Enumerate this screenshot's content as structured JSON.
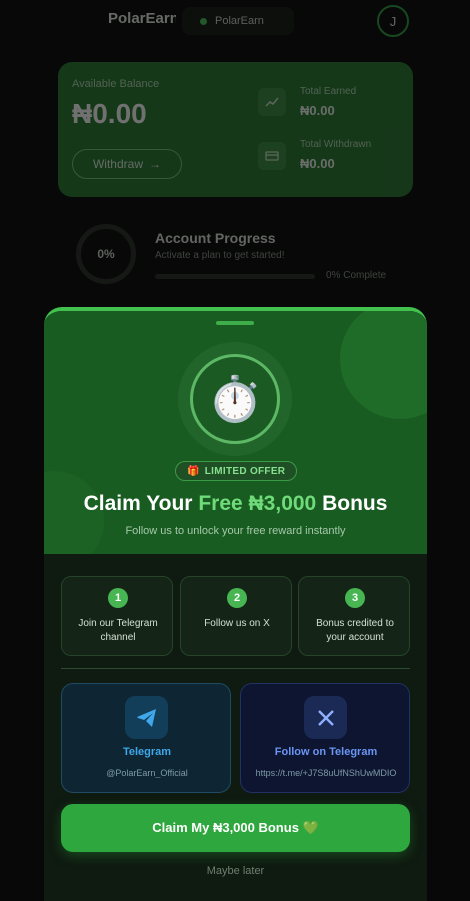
{
  "app": {
    "logo_text": "PolarEarn",
    "brand_pill": "PolarEarn",
    "avatar_initial": "J"
  },
  "balance": {
    "label": "Available Balance",
    "value": "₦0.00",
    "withdraw_label": "Withdraw",
    "withdraw_icon": "→",
    "total_earned_label": "Total Earned",
    "total_earned_value": "₦0.00",
    "total_withdrawn_label": "Total Withdrawn",
    "total_withdrawn_value": "₦0.00"
  },
  "progress": {
    "percent_text": "0%",
    "title": "Account Progress",
    "subtitle": "Activate a plan to get started!",
    "complete_text": "0% Complete",
    "fraction": 0
  },
  "modal": {
    "badge_icon": "🎁",
    "badge_text": "LIMITED OFFER",
    "timer_icon": "⏱️",
    "headline_prefix": "Claim Your ",
    "headline_highlight": "Free ₦3,000",
    "headline_suffix": " Bonus",
    "subheadline": "Follow us to unlock your free reward instantly",
    "steps": [
      {
        "num": "1",
        "text": "Join our Telegram channel"
      },
      {
        "num": "2",
        "text": "Follow us on X"
      },
      {
        "num": "3",
        "text": "Bonus credited to your account"
      }
    ],
    "telegram": {
      "title": "Telegram",
      "handle": "@PolarEarn_Official"
    },
    "x_card": {
      "title": "Follow on Telegram",
      "handle": "https://t.me/+J7S8uUfNShUwMDIO"
    },
    "claim_label": "Claim My ₦3,000 Bonus 💚",
    "maybe_later": "Maybe later"
  },
  "colors": {
    "accent_green": "#43c14f",
    "telegram_blue": "#3fa7ea",
    "x_blue": "#6a95f4"
  }
}
